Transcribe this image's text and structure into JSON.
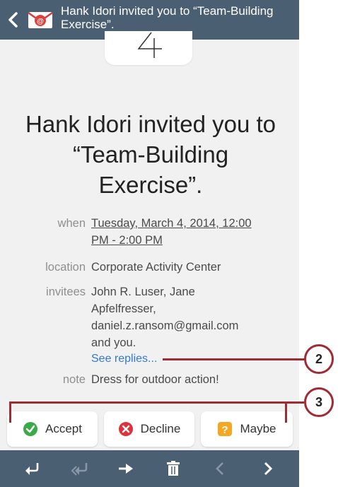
{
  "header": {
    "title": "Hank Idori invited you to “Team-Building Exercise”."
  },
  "date_card": {
    "day": "4"
  },
  "invite": {
    "title": "Hank Idori invited you to “Team-Building Exercise”."
  },
  "details": {
    "when_label": "when",
    "when_line1": "Tuesday, March 4, 2014, 12:00",
    "when_line2": "PM - 2:00 PM",
    "location_label": "location",
    "location_value": "Corporate Activity Center",
    "invitees_label": "invitees",
    "invitees_line1": "John R. Luser, Jane",
    "invitees_line2": "Apfelfresser,",
    "invitees_line3": "daniel.z.ransom@gmail.com",
    "invitees_line4": "and you.",
    "see_replies": "See replies...",
    "note_label": "note",
    "note_value": "Dress for outdoor action!"
  },
  "actions": {
    "accept": "Accept",
    "decline": "Decline",
    "maybe": "Maybe"
  },
  "bottom_bar": {
    "icons": [
      "reply-icon",
      "reply-all-icon",
      "forward-icon",
      "delete-icon",
      "previous-icon",
      "next-icon"
    ]
  },
  "callouts": {
    "two": "2",
    "three": "3"
  },
  "colors": {
    "bar": "#4b5f73",
    "link": "#2a52b8",
    "callout": "#a02b34",
    "accept": "#3bab4a",
    "decline": "#e0313b",
    "maybe": "#f5a623"
  }
}
